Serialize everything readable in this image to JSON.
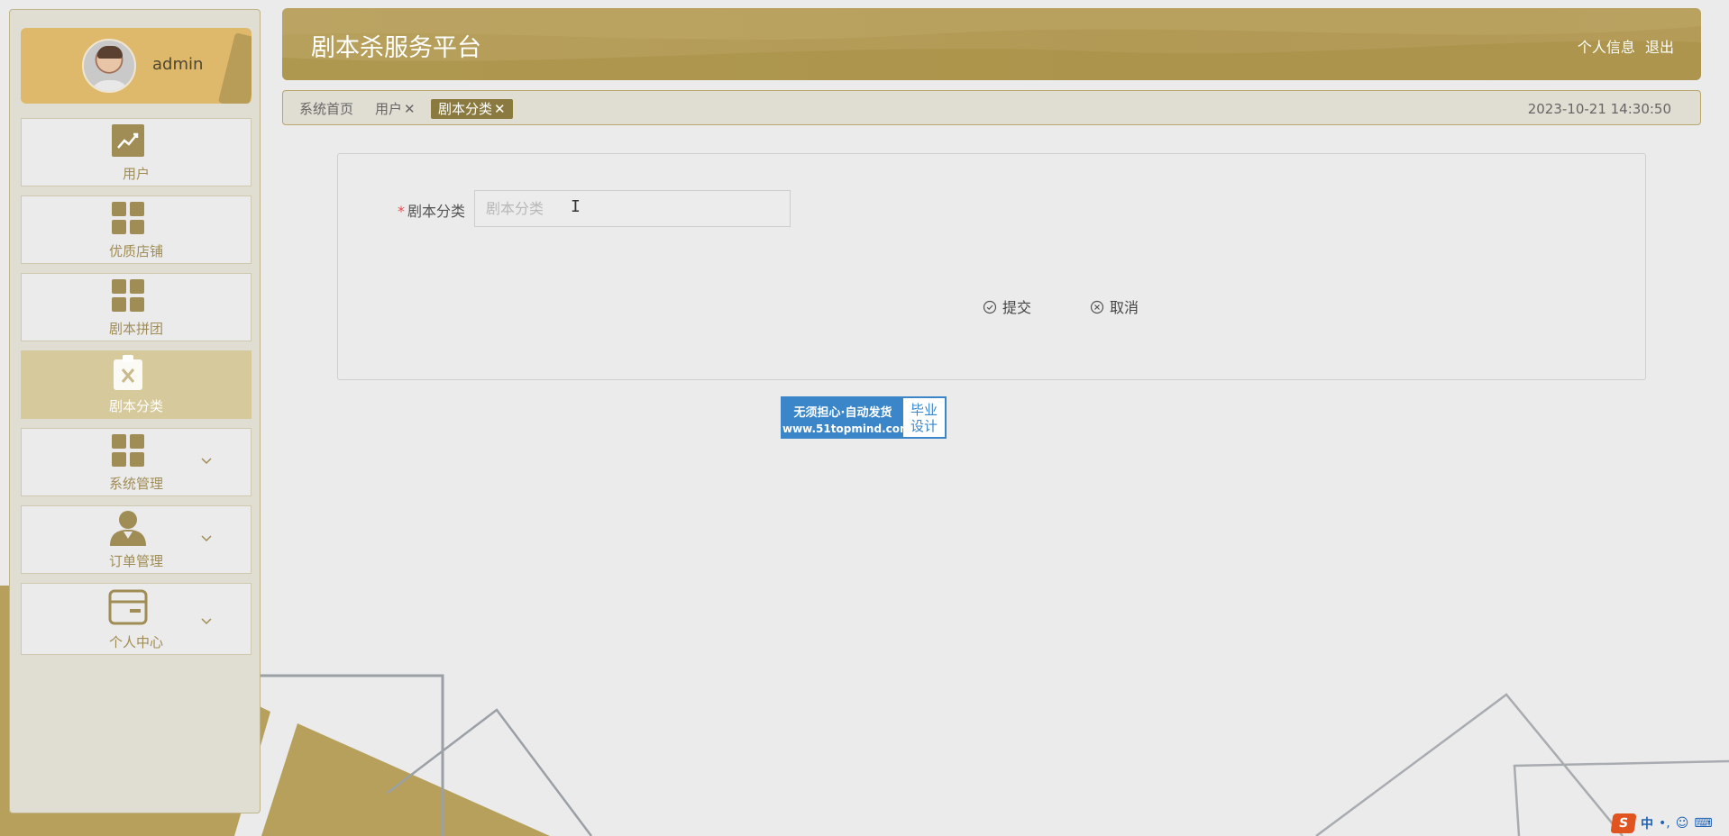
{
  "colors": {
    "accent": "#b29a55",
    "active_tab": "#8b7a40",
    "sidebar_bg": "#e0ddd2",
    "required": "#e0524e",
    "ad_blue": "#3a86c9"
  },
  "sidebar": {
    "user": {
      "name": "admin",
      "avatar_icon": "avatar-photo"
    },
    "items": [
      {
        "label": "用户",
        "icon": "chart-icon",
        "active": false,
        "expandable": false
      },
      {
        "label": "优质店铺",
        "icon": "grid-icon",
        "active": false,
        "expandable": false
      },
      {
        "label": "剧本拼团",
        "icon": "grid-icon",
        "active": false,
        "expandable": false
      },
      {
        "label": "剧本分类",
        "icon": "clipboard-x-icon",
        "active": true,
        "expandable": false
      },
      {
        "label": "系统管理",
        "icon": "grid-icon",
        "active": false,
        "expandable": true
      },
      {
        "label": "订单管理",
        "icon": "person-icon",
        "active": false,
        "expandable": true
      },
      {
        "label": "个人中心",
        "icon": "wallet-icon",
        "active": false,
        "expandable": true
      }
    ]
  },
  "header": {
    "title": "剧本杀服务平台",
    "links": {
      "profile": "个人信息",
      "logout": "退出"
    }
  },
  "tabs": {
    "items": [
      {
        "label": "系统首页",
        "closable": false,
        "active": false
      },
      {
        "label": "用户",
        "closable": true,
        "active": false
      },
      {
        "label": "剧本分类",
        "closable": true,
        "active": true
      }
    ],
    "close_glyph": "✕",
    "datetime": "2023-10-21 14:30:50"
  },
  "form": {
    "field": {
      "required_mark": "*",
      "label": "剧本分类",
      "value": "",
      "placeholder": "剧本分类"
    },
    "cursor_glyph": "I",
    "submit_label": "提交",
    "cancel_label": "取消"
  },
  "ad": {
    "line1": "无须担心·自动发货",
    "line2": "www.51topmind.com",
    "right_line1": "毕业",
    "right_line2": "设计"
  },
  "ime": {
    "logo": "S",
    "lang": "中",
    "punct": "•,",
    "emoji": "☺",
    "keyboard": "⌨"
  }
}
